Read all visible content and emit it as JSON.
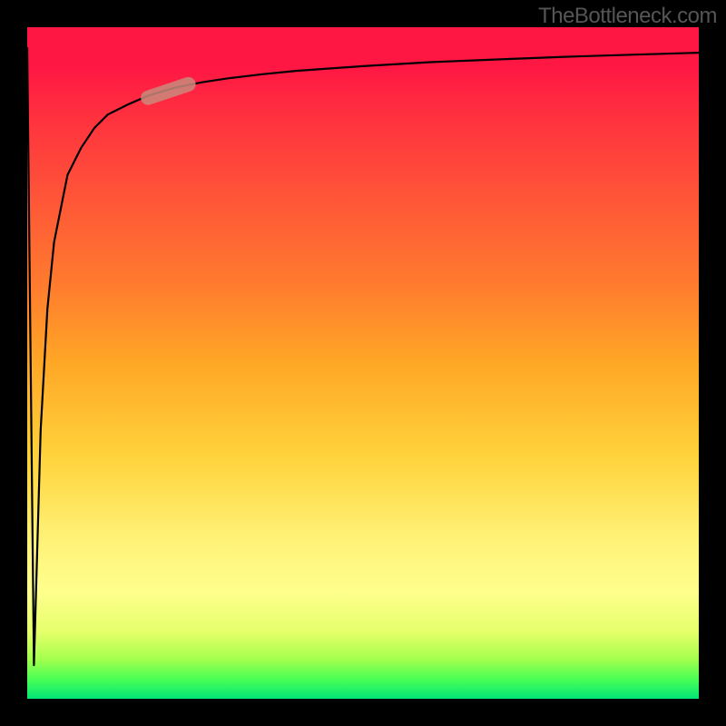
{
  "attribution": "TheBottleneck.com",
  "chart_data": {
    "type": "line",
    "title": "",
    "xlabel": "",
    "ylabel": "",
    "xlim": [
      0,
      100
    ],
    "ylim": [
      0,
      100
    ],
    "grid": false,
    "legend": false,
    "series": [
      {
        "name": "curve",
        "x": [
          0,
          1,
          2,
          3,
          4,
          6,
          8,
          10,
          12,
          15,
          18,
          22,
          26,
          30,
          35,
          40,
          50,
          60,
          70,
          80,
          90,
          100
        ],
        "y": [
          97,
          5,
          40,
          58,
          68,
          78,
          82,
          85,
          87,
          88.5,
          89.8,
          91,
          91.8,
          92.4,
          93,
          93.5,
          94.2,
          94.8,
          95.2,
          95.6,
          95.9,
          96.2
        ]
      }
    ],
    "marker": {
      "x_range": [
        18,
        24
      ],
      "y_range": [
        89.5,
        91.5
      ],
      "color": "#c98a7d"
    },
    "background_gradient": {
      "type": "vertical",
      "stops": [
        {
          "pos": 0.0,
          "color": "#ff1744"
        },
        {
          "pos": 0.5,
          "color": "#ffa726"
        },
        {
          "pos": 0.8,
          "color": "#ffff8d"
        },
        {
          "pos": 1.0,
          "color": "#00e676"
        }
      ]
    }
  }
}
